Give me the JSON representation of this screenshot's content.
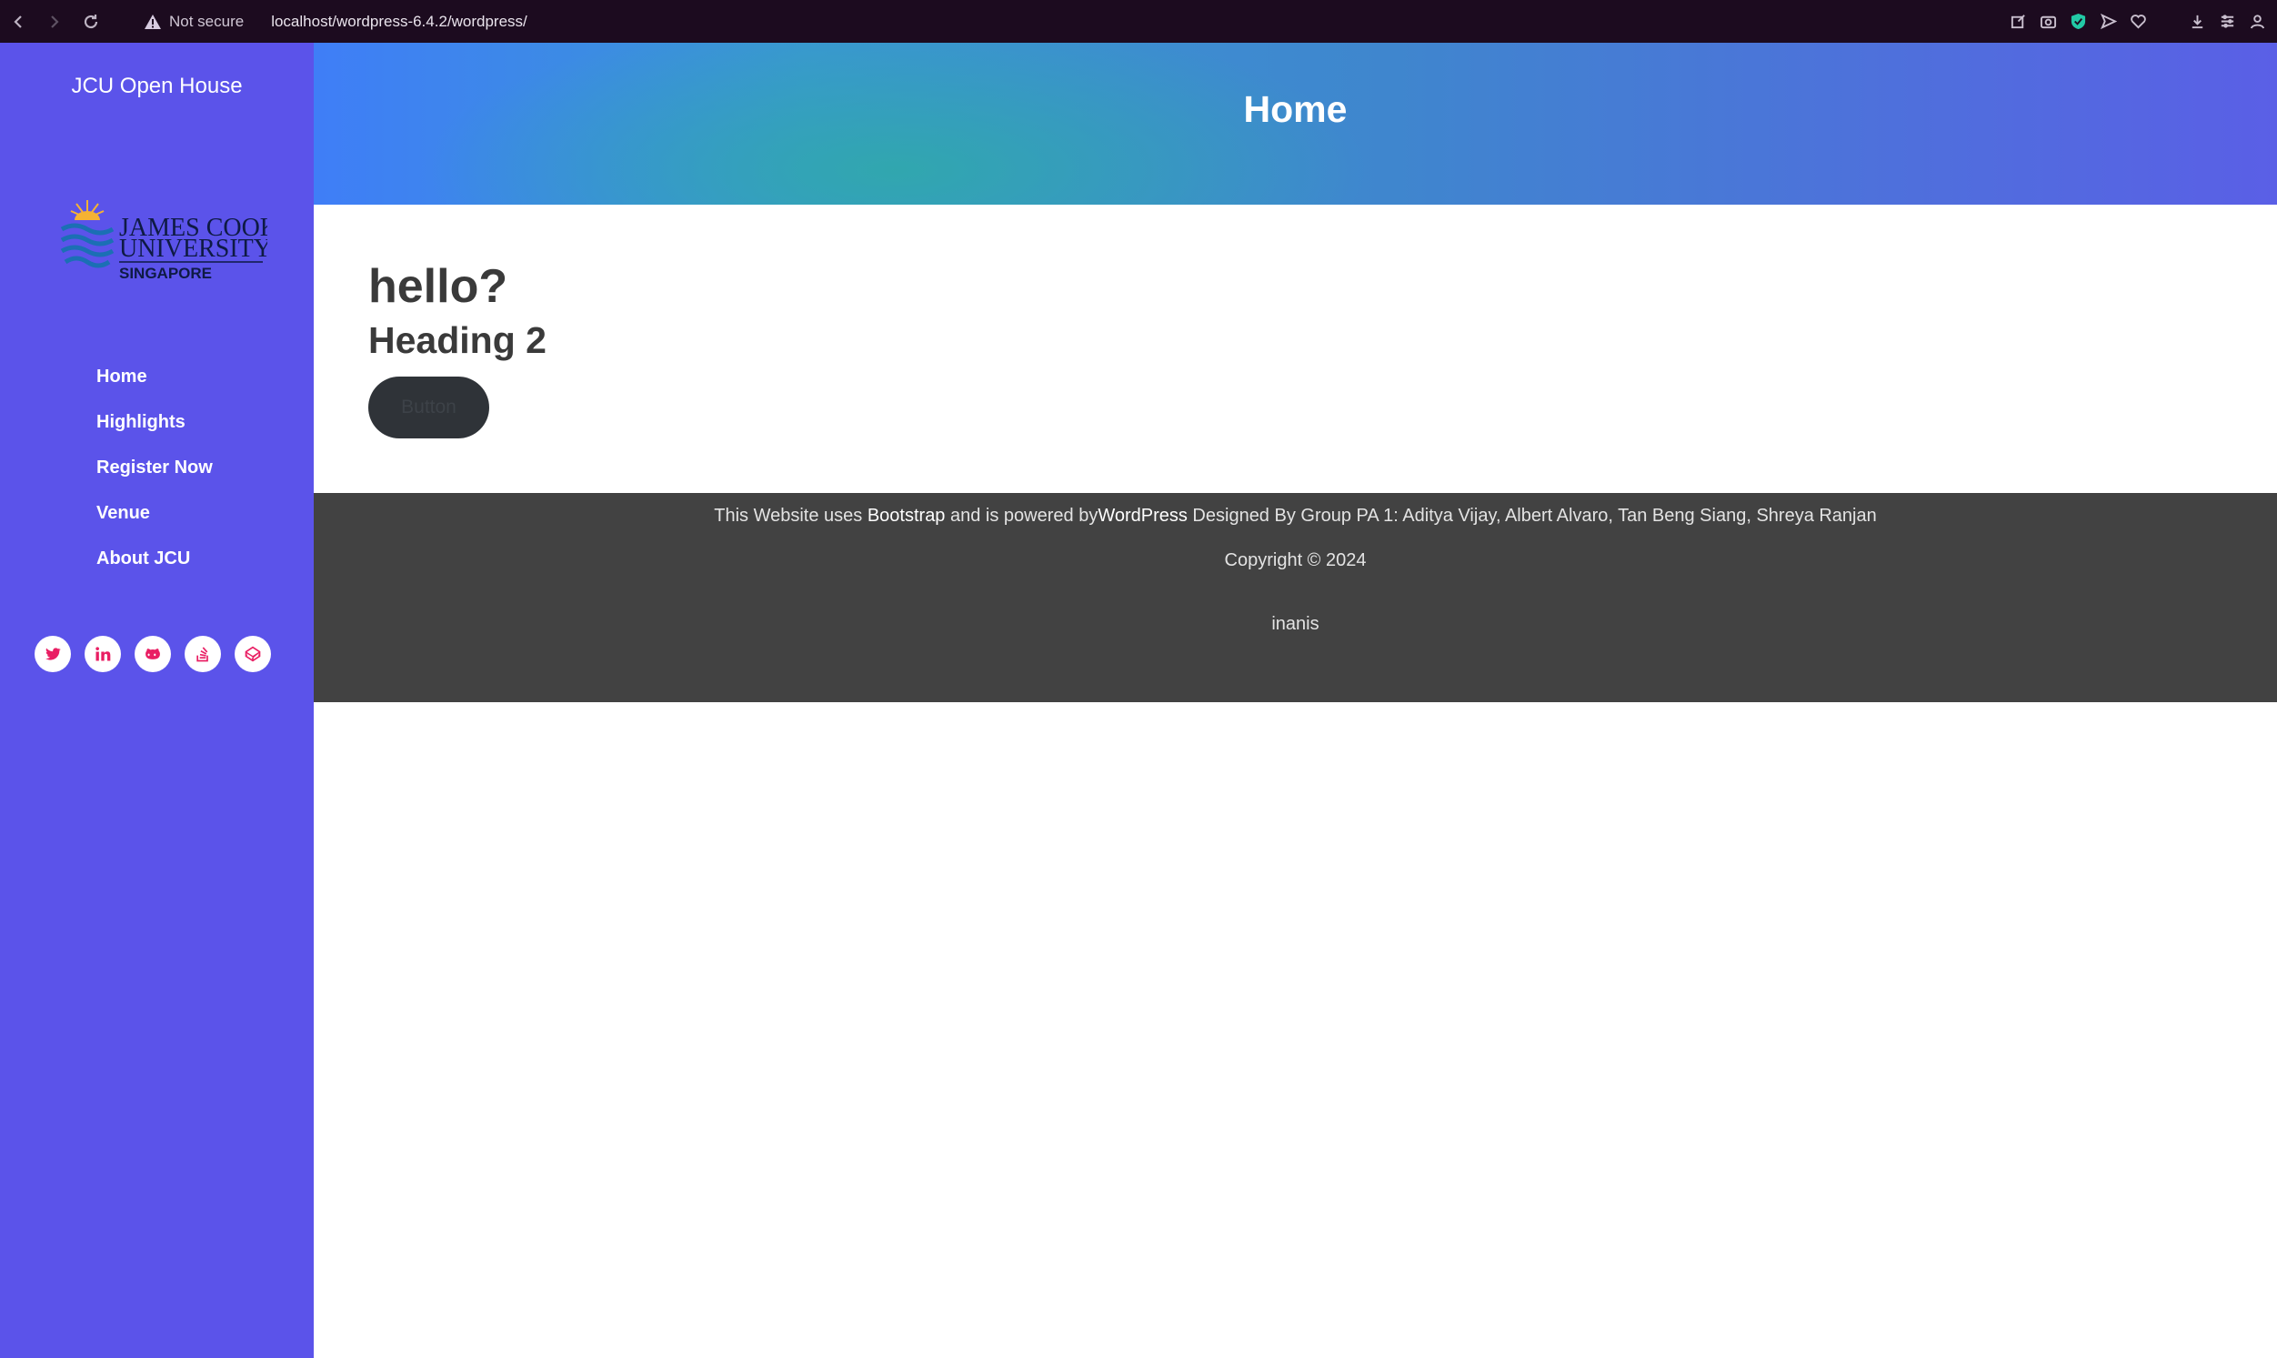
{
  "browser": {
    "security_label": "Not secure",
    "url": "localhost/wordpress-6.4.2/wordpress/"
  },
  "sidebar": {
    "site_title": "JCU Open House",
    "logo": {
      "line1": "JAMES COOK",
      "line2": "UNIVERSITY",
      "line3": "SINGAPORE"
    },
    "nav": [
      {
        "label": "Home"
      },
      {
        "label": "Highlights"
      },
      {
        "label": "Register Now"
      },
      {
        "label": "Venue"
      },
      {
        "label": "About JCU"
      }
    ],
    "socials": [
      "twitter-icon",
      "linkedin-icon",
      "github-icon",
      "stackoverflow-icon",
      "codepen-icon"
    ]
  },
  "header": {
    "title": "Home"
  },
  "main": {
    "heading1": "hello?",
    "heading2": "Heading 2",
    "button_label": "Button"
  },
  "footer": {
    "text_prefix": "This Website uses ",
    "bootstrap_link": "Bootstrap",
    "text_middle": " and is powered by",
    "wordpress_link": "WordPress",
    "text_suffix": " Designed By Group PA 1: Aditya Vijay, Albert Alvaro, Tan Beng Siang, Shreya Ranjan",
    "copyright": "Copyright © 2024",
    "theme": "inanis"
  },
  "colors": {
    "sidebar": "#5b53ea",
    "chrome": "#1c0b1f",
    "footer": "#424242",
    "social_icon": "#e91e63"
  }
}
